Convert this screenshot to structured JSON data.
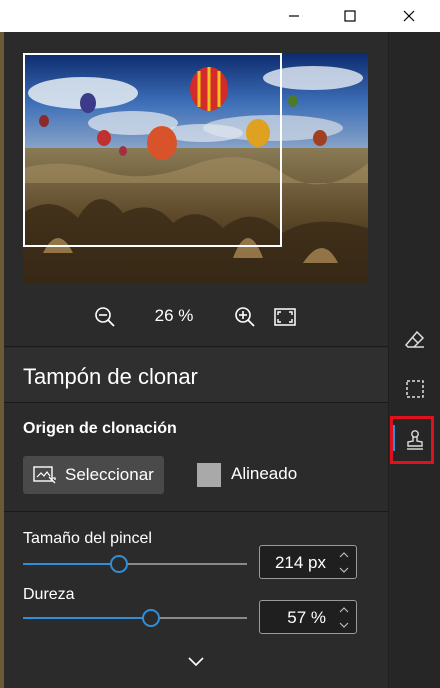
{
  "window": {
    "minimize_icon": "minimize-icon",
    "maximize_icon": "maximize-icon",
    "close_icon": "close-icon"
  },
  "preview": {
    "image": "hot-air-balloons-landscape"
  },
  "zoom": {
    "percent": "26 %",
    "zoom_out_icon": "zoom-out-icon",
    "zoom_in_icon": "zoom-in-icon",
    "fit_icon": "fit-to-screen-icon"
  },
  "tool": {
    "title": "Tampón de clonar"
  },
  "origin": {
    "heading": "Origen de clonación",
    "select_label": "Seleccionar",
    "aligned_label": "Alineado",
    "aligned_checked": false
  },
  "brush": {
    "size_label": "Tamaño del pincel",
    "size_value": "214 px",
    "size_fraction": 0.43,
    "hardness_label": "Dureza",
    "hardness_value": "57 %",
    "hardness_fraction": 0.57
  },
  "rail": {
    "items": [
      "eraser-icon",
      "selection-icon",
      "clone-stamp-icon"
    ],
    "active": "clone-stamp-icon"
  },
  "colors": {
    "accent": "#2f8fd6",
    "highlight": "#e0101c",
    "panel": "#2b2b2b"
  }
}
